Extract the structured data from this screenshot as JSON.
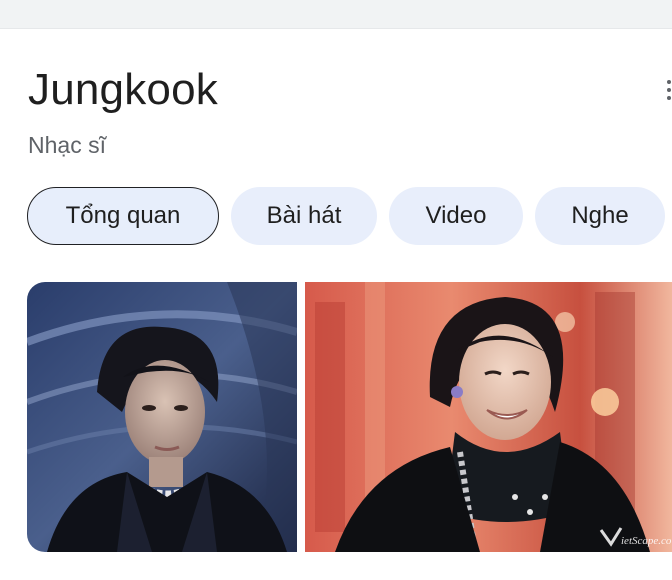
{
  "header": {
    "title": "Jungkook",
    "subtitle": "Nhạc sĩ"
  },
  "tabs": [
    {
      "label": "Tổng quan",
      "active": true
    },
    {
      "label": "Bài hát",
      "active": false
    },
    {
      "label": "Video",
      "active": false
    },
    {
      "label": "Nghe",
      "active": false
    }
  ],
  "images": {
    "left": {
      "description_icon": "portrait-photo"
    },
    "right": {
      "description_icon": "portrait-photo",
      "watermark": "VietScape.co"
    }
  },
  "colors": {
    "chip_background": "#e8eefb",
    "active_chip_border": "#202124",
    "title_text": "#1f1f1f",
    "subtitle_text": "#5f6368"
  }
}
